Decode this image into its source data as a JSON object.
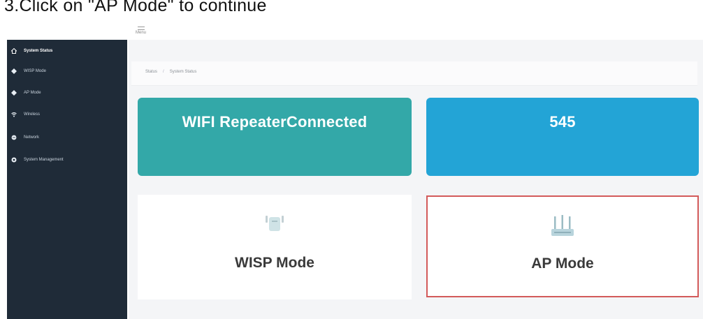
{
  "instruction": "3.Click on \"AP Mode\" to continue",
  "header": {
    "menu_label": "Menu"
  },
  "sidebar": {
    "items": [
      {
        "label": "System Status",
        "icon": "home-icon",
        "active": true
      },
      {
        "label": "WISP Mode",
        "icon": "diamond-icon",
        "active": false
      },
      {
        "label": "AP Mode",
        "icon": "diamond-icon",
        "active": false
      },
      {
        "label": "Wireless",
        "icon": "wifi-icon",
        "active": false
      },
      {
        "label": "Network",
        "icon": "globe-icon",
        "active": false
      },
      {
        "label": "System Management",
        "icon": "gear-icon",
        "active": false
      }
    ]
  },
  "breadcrumb": {
    "root": "Status",
    "current": "System Status"
  },
  "cards": {
    "status_title": "WIFI RepeaterConnected",
    "clients_title": "545"
  },
  "modes": {
    "wisp_label": "WISP Mode",
    "ap_label": "AP Mode"
  },
  "colors": {
    "sidebar": "#1f2b38",
    "status_card": "#33a8a8",
    "clients_card": "#23a4d6",
    "highlight_border": "#d35a5a"
  }
}
